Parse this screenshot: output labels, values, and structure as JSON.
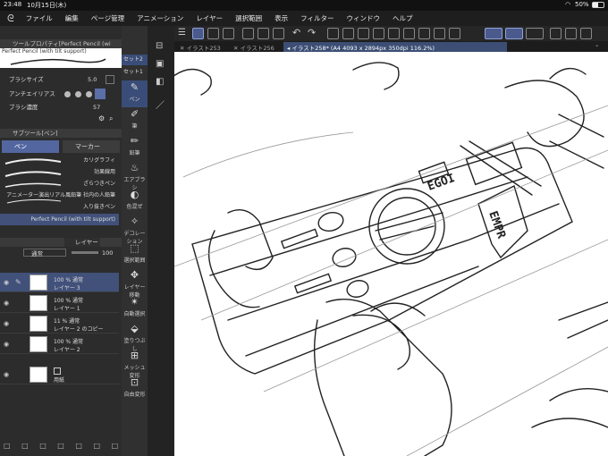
{
  "status": {
    "time": "23:48",
    "date": "10月15日(木)",
    "battery": "50%"
  },
  "menu": [
    "ファイル",
    "編集",
    "ページ管理",
    "アニメーション",
    "レイヤー",
    "選択範囲",
    "表示",
    "フィルター",
    "ウィンドウ",
    "ヘルプ"
  ],
  "tabs": [
    "イラスト253",
    "イラスト256",
    "イラスト258* (A4 4093 x 2894px 350dpi 116.2%)"
  ],
  "tool_property": {
    "title": "ツールプロパティ[Perfect Pencil (wi",
    "brush_name": "Perfect Pencil (with tilt support)",
    "brush_size_label": "ブラシサイズ",
    "brush_size_value": "5.0",
    "antialias_label": "アンチエイリアス",
    "brush_density_label": "ブラシ濃度",
    "brush_density_value": "57"
  },
  "subtool": {
    "title": "サブツール[ペン]",
    "tab_pen": "ペン",
    "tab_marker": "マーカー",
    "items": [
      "カリグラフィ",
      "効果線用",
      "ざらつきペン",
      "アニメーター演出リアル風鉛筆 社内の人鉛筆",
      "入り抜きペン",
      "Perfect Pencil (with tilt support)"
    ]
  },
  "layers": {
    "tab_label": "レイヤー",
    "blend_mode": "通常",
    "opacity": "100",
    "items": [
      {
        "opacity": "100 % 通常",
        "name": "レイヤー 3",
        "active": true
      },
      {
        "opacity": "100 % 通常",
        "name": "レイヤー 1",
        "active": false
      },
      {
        "opacity": "11 % 通常",
        "name": "レイヤー 2 のコピー",
        "active": false
      },
      {
        "opacity": "100 % 通常",
        "name": "レイヤー 2",
        "active": false
      },
      {
        "opacity": "",
        "name": "用紙",
        "active": false
      }
    ]
  },
  "toolbar_sets": {
    "set2": "セット2",
    "set1": "セット1"
  },
  "tools": [
    {
      "label": "ペン",
      "icon": "pen-icon",
      "glyph": "✎",
      "active": true
    },
    {
      "label": "筆",
      "icon": "brush-icon",
      "glyph": "✐",
      "active": false
    },
    {
      "label": "鉛筆",
      "icon": "pencil-icon",
      "glyph": "✏",
      "active": false
    },
    {
      "label": "エアブラシ",
      "icon": "airbrush-icon",
      "glyph": "♨",
      "active": false
    },
    {
      "label": "色混ぜ",
      "icon": "blend-icon",
      "glyph": "◐",
      "active": false
    },
    {
      "label": "デコレーション",
      "icon": "decoration-icon",
      "glyph": "✧",
      "active": false
    },
    {
      "label": "選択範囲",
      "icon": "selection-icon",
      "glyph": "⬚",
      "active": false
    },
    {
      "label": "レイヤー移動",
      "icon": "move-icon",
      "glyph": "✥",
      "active": false
    },
    {
      "label": "自動選択",
      "icon": "auto-select-icon",
      "glyph": "✴",
      "active": false
    },
    {
      "label": "塗りつぶし",
      "icon": "fill-icon",
      "glyph": "⬙",
      "active": false
    },
    {
      "label": "メッシュ変形",
      "icon": "mesh-icon",
      "glyph": "⊞",
      "active": false
    },
    {
      "label": "自由変形",
      "icon": "transform-icon",
      "glyph": "⊡",
      "active": false
    }
  ]
}
